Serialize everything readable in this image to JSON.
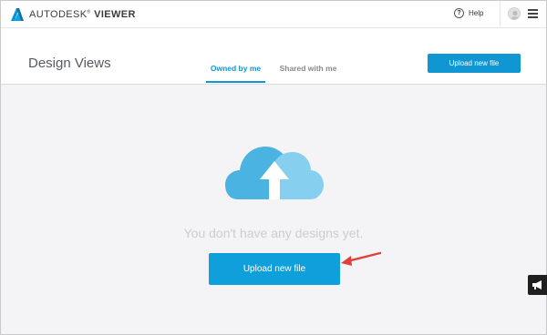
{
  "topbar": {
    "brand_light": "AUTODESK",
    "brand_bold": "VIEWER",
    "help_label": "Help",
    "logo_color": "#0696d7"
  },
  "header": {
    "title": "Design Views",
    "tabs": [
      {
        "label": "Owned by me",
        "active": true
      },
      {
        "label": "Shared with me",
        "active": false
      }
    ],
    "upload_button_label": "Upload new file"
  },
  "main": {
    "empty_message": "You don't have any designs yet.",
    "upload_button_label": "Upload new file"
  },
  "colors": {
    "accent": "#0f96d3",
    "button_main": "#0fa0dc",
    "cloud_dark": "#4ab3e2",
    "cloud_light": "#86cfee",
    "annotation_arrow": "#e0403a"
  },
  "icons": {
    "logo": "autodesk-logo-icon",
    "help": "question-circle-icon",
    "avatar": "user-avatar-icon",
    "menu": "hamburger-menu-icon",
    "cloud": "cloud-upload-icon",
    "feedback": "megaphone-icon"
  }
}
